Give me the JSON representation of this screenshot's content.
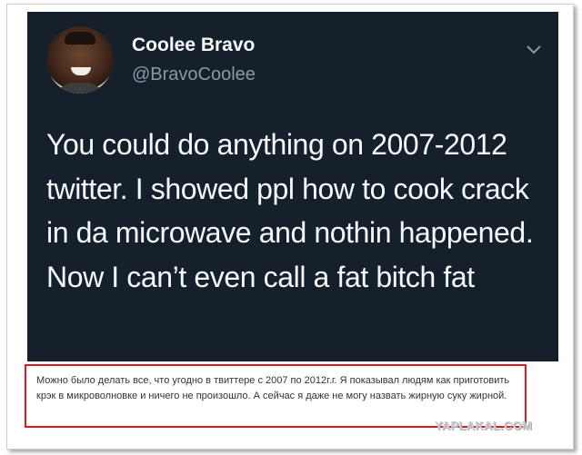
{
  "tweet": {
    "display_name": "Coolee Bravo",
    "handle": "@BravoCoolee",
    "text": "You could do anything on 2007-2012 twitter. I showed ppl how to cook crack in da microwave and nothin happened. Now I can’t even call a fat bitch fat",
    "more_icon": "chevron-down-icon"
  },
  "caption": {
    "text": "Можно было делать все, что угодно в твиттере с 2007 по 2012г.г. Я показывал людям как приготовить крэк в микроволновке и ничего не произошло. А сейчас я даже не могу назвать жирную суку жирной."
  },
  "watermark": {
    "text": "YAPLAKAL.COM"
  },
  "colors": {
    "tweet_bg": "#15202b",
    "caption_border": "#e0191e"
  }
}
